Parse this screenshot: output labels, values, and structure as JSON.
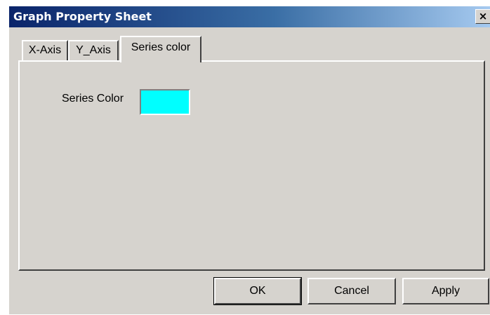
{
  "window": {
    "title": "Graph Property Sheet",
    "close_label": "×"
  },
  "tabs": [
    {
      "label": "X-Axis",
      "selected": false
    },
    {
      "label": "Y_Axis",
      "selected": false
    },
    {
      "label": "Series color",
      "selected": true
    }
  ],
  "panel": {
    "series_color_label": "Series Color",
    "series_color_value": "#00ffff"
  },
  "buttons": {
    "ok_label": "OK",
    "cancel_label": "Cancel",
    "apply_label": "Apply"
  },
  "colors": {
    "dialog_face": "#d6d3ce",
    "title_active": "#0a246a",
    "swatch": "#00ffff"
  }
}
